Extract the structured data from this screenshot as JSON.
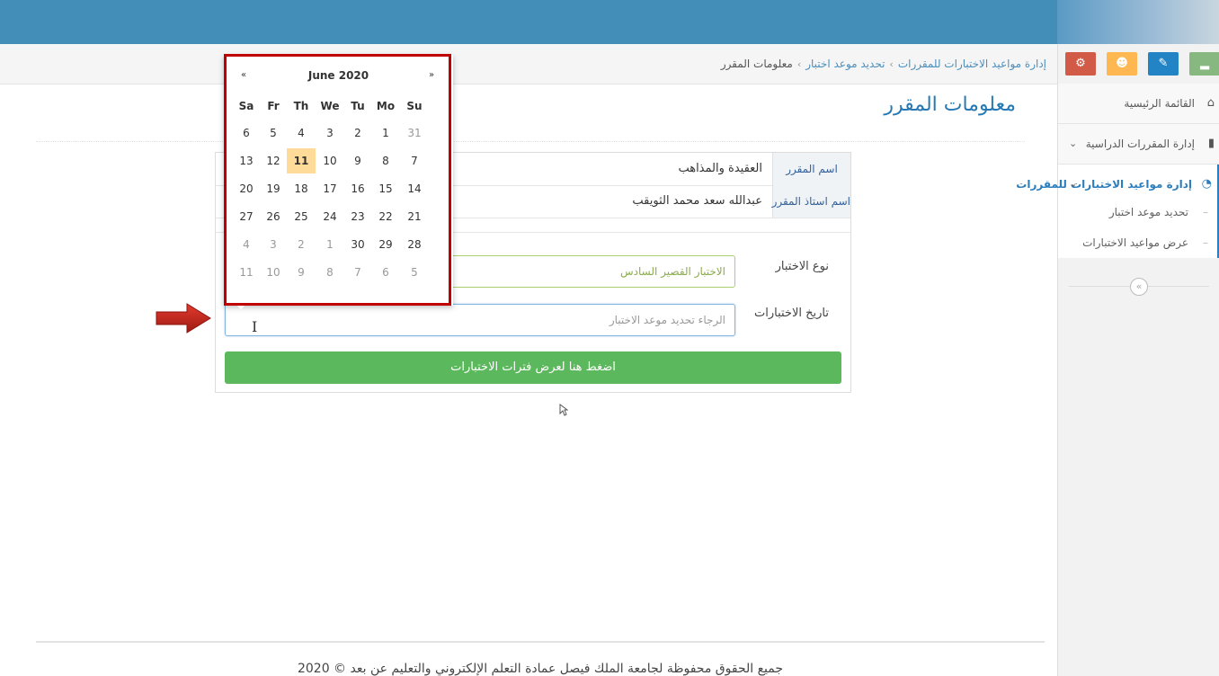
{
  "breadcrumb": [
    "إدارة مواعيد الاختبارات للمقررات",
    "تحديد موعد اختبار",
    "معلومات المقرر"
  ],
  "sidebar": {
    "shortcut_buttons": [
      {
        "name": "stats",
        "icon": "▂",
        "color": "#87b87f"
      },
      {
        "name": "edit",
        "icon": "✎",
        "color": "#2283c5"
      },
      {
        "name": "users",
        "icon": "☻",
        "color": "#ffb752"
      },
      {
        "name": "settings",
        "icon": "⚙",
        "color": "#d15b47"
      }
    ],
    "items": [
      {
        "label": "القائمة الرئيسية",
        "icon": "⌂"
      },
      {
        "label": "إدارة المقررات الدراسية",
        "icon": "▮",
        "chevron": "⌄"
      },
      {
        "label": "إدارة مواعيد الاختبارات للمقررات",
        "icon": "◔",
        "chevron": "⌄",
        "active": true
      }
    ],
    "subitems": [
      "تحديد موعد اختبار",
      "عرض مواعيد الاختبارات"
    ],
    "collapse_icon": "«"
  },
  "page": {
    "title": "معلومات المقرر",
    "course_name_label": "اسم المقرر",
    "course_name_value": "العقيدة والمذاهب",
    "instructor_label": "اسم استاذ المقرر",
    "instructor_value": "عبدالله سعد محمد الثويقب",
    "exam_type_label": "نوع الاختبار",
    "exam_type_value": "الاختبار القصير السادس",
    "exam_date_label": "تاريخ الاختبارات",
    "exam_date_placeholder": "الرجاء تحديد موعد الاختبار",
    "show_button": "اضغط هنا لعرض فترات الاختبارات"
  },
  "datepicker": {
    "title": "June 2020",
    "prev": "«",
    "next": "»",
    "days_of_week": [
      "Sa",
      "Fr",
      "Th",
      "We",
      "Tu",
      "Mo",
      "Su"
    ],
    "weeks": [
      [
        "6",
        "5",
        "4",
        "3",
        "2",
        "1",
        "31"
      ],
      [
        "13",
        "12",
        "11",
        "10",
        "9",
        "8",
        "7"
      ],
      [
        "20",
        "19",
        "18",
        "17",
        "16",
        "15",
        "14"
      ],
      [
        "27",
        "26",
        "25",
        "24",
        "23",
        "22",
        "21"
      ],
      [
        "4",
        "3",
        "2",
        "1",
        "30",
        "29",
        "28"
      ],
      [
        "11",
        "10",
        "9",
        "8",
        "7",
        "6",
        "5"
      ]
    ],
    "other_month": [
      [
        false,
        false,
        false,
        false,
        false,
        false,
        true
      ],
      [
        false,
        false,
        false,
        false,
        false,
        false,
        false
      ],
      [
        false,
        false,
        false,
        false,
        false,
        false,
        false
      ],
      [
        false,
        false,
        false,
        false,
        false,
        false,
        false
      ],
      [
        true,
        true,
        true,
        true,
        false,
        false,
        false
      ],
      [
        true,
        true,
        true,
        true,
        true,
        true,
        true
      ]
    ],
    "today": "11"
  },
  "footer": "جميع الحقوق محفوظة لجامعة الملك فيصل عمادة التعلم الإلكتروني والتعليم عن بعد © 2020"
}
